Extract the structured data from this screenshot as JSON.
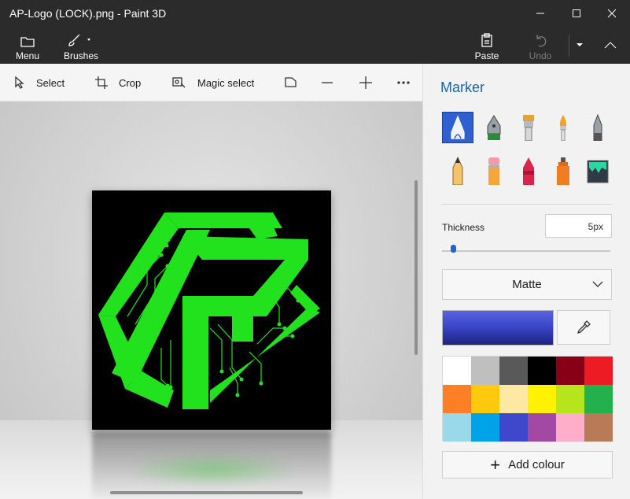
{
  "window": {
    "title": "AP-Logo (LOCK).png - Paint 3D"
  },
  "ribbon": {
    "menu_label": "Menu",
    "brushes_label": "Brushes",
    "paste_label": "Paste",
    "undo_label": "Undo"
  },
  "toolbar": {
    "select_label": "Select",
    "crop_label": "Crop",
    "magic_select_label": "Magic select"
  },
  "panel": {
    "title": "Marker",
    "brushes": [
      "marker",
      "calligraphy-pen",
      "oil-brush",
      "watercolor",
      "pixel-pen",
      "pencil",
      "eraser",
      "crayon",
      "spray-can",
      "fill"
    ],
    "thickness_label": "Thickness",
    "thickness_value": "5px",
    "thickness_level": 0.05,
    "finish_value": "Matte",
    "current_colour": "#3b47c9",
    "palette": [
      "#ffffff",
      "#bfbfbf",
      "#595959",
      "#000000",
      "#880015",
      "#ed1c24",
      "#ff7f27",
      "#ffc90e",
      "#fde9a4",
      "#fff200",
      "#b5e61d",
      "#22b14c",
      "#99d9ea",
      "#00a2e8",
      "#3f48cc",
      "#a349a4",
      "#ffaec9",
      "#b97a57"
    ],
    "add_colour_label": "Add colour"
  },
  "canvas": {
    "logo_color": "#21e21c",
    "background_color": "#000000"
  }
}
